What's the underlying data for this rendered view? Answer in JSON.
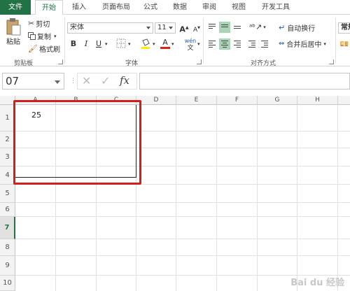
{
  "tabs": [
    {
      "label": "文件",
      "active": false,
      "file": true
    },
    {
      "label": "开始",
      "active": true
    },
    {
      "label": "插入"
    },
    {
      "label": "页面布局"
    },
    {
      "label": "公式"
    },
    {
      "label": "数据"
    },
    {
      "label": "审阅"
    },
    {
      "label": "视图"
    },
    {
      "label": "开发工具"
    }
  ],
  "clipboard": {
    "paste_label": "粘贴",
    "cut_label": "剪切",
    "copy_label": "复制",
    "format_painter_label": "格式刷",
    "group_label": "剪贴板"
  },
  "font": {
    "font_name": "宋体",
    "font_size": "11",
    "bold_label": "B",
    "italic_label": "I",
    "underline_label": "U",
    "grow_label": "A",
    "shrink_label": "A",
    "text_color_label": "A",
    "phonetic_label": "wén",
    "group_label": "字体"
  },
  "alignment": {
    "wrap_text_label": "自动换行",
    "merge_center_label": "合并后居中",
    "group_label": "对齐方式"
  },
  "number": {
    "format_value": "常规"
  },
  "formula_bar": {
    "name_box": "07",
    "fx_label": "fx",
    "formula": ""
  },
  "columns": [
    "A",
    "B",
    "C",
    "D",
    "E",
    "F",
    "G",
    "H"
  ],
  "rows": [
    "1",
    "2",
    "3",
    "4",
    "5",
    "6",
    "7",
    "8",
    "9",
    "10"
  ],
  "active_row": "7",
  "cells": {
    "A1": "25"
  },
  "watermark": "Bai du 经验",
  "colors": {
    "accent": "#217346",
    "highlight": "#d0201b"
  }
}
